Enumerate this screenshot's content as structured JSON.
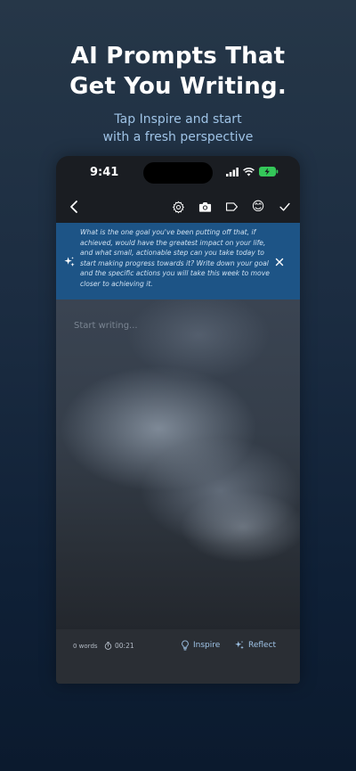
{
  "headline": {
    "line1": "AI Prompts That",
    "line2": "Get You Writing."
  },
  "subhead": {
    "line1": "Tap Inspire and start",
    "line2": "with a fresh perspective"
  },
  "status_bar": {
    "time": "9:41"
  },
  "toolbar": {
    "back_icon": "chevron-left-icon",
    "settings_icon": "gear-icon",
    "camera_icon": "camera-icon",
    "tag_icon": "tag-icon",
    "mood_icon": "emoji",
    "mood_glyph": "😊",
    "done_icon": "checkmark-icon"
  },
  "prompt": {
    "text": "What is the one goal you've been putting off that, if achieved, would have the greatest impact on your life, and what small, actionable step can you take today to start making progress towards it? Write down your goal and the specific actions you will take this week to move closer to achieving it.",
    "spark_icon": "sparkle-icon",
    "close_icon": "close-icon"
  },
  "editor": {
    "placeholder": "Start writing..."
  },
  "footer": {
    "word_count": "0 words",
    "timer": "00:21",
    "inspire_label": "Inspire",
    "reflect_label": "Reflect"
  },
  "colors": {
    "prompt_bg": "#1d5486",
    "accent": "#9fc3e6"
  }
}
